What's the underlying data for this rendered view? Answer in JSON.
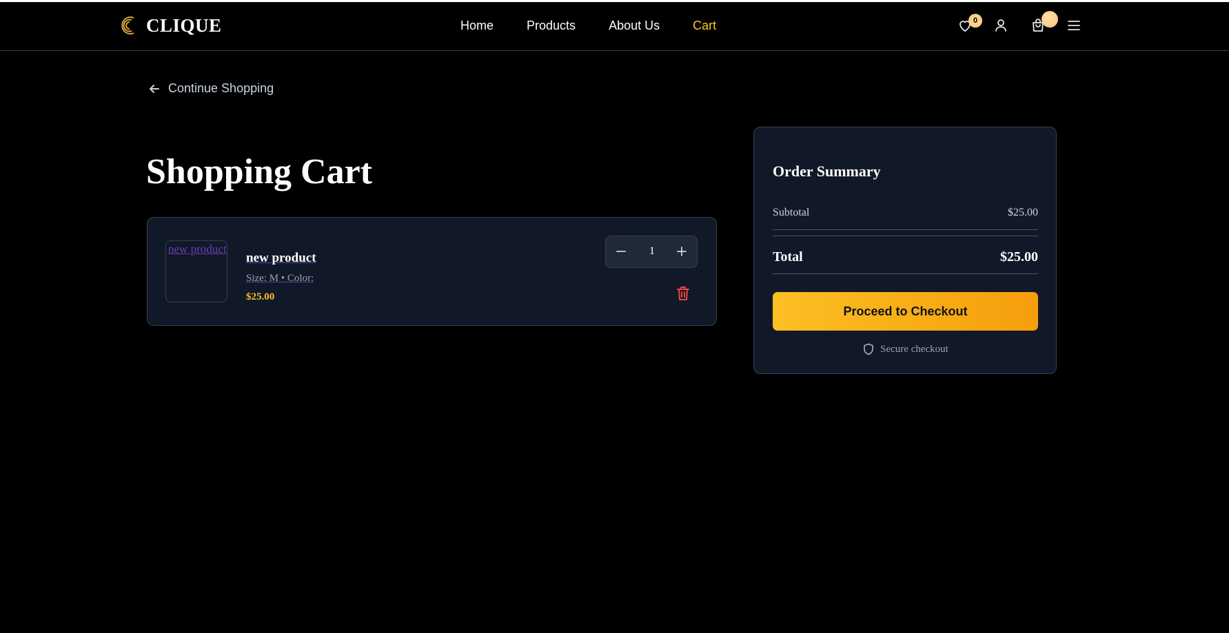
{
  "header": {
    "brand": "CLIQUE",
    "nav": [
      {
        "label": "Home",
        "active": false
      },
      {
        "label": "Products",
        "active": false
      },
      {
        "label": "About Us",
        "active": false
      },
      {
        "label": "Cart",
        "active": true
      }
    ],
    "wishlist_count": "0",
    "icons": [
      "heart-icon",
      "user-icon",
      "shopping-bag-icon",
      "menu-icon"
    ]
  },
  "back_link": "Continue Shopping",
  "page_title": "Shopping Cart",
  "cart": {
    "items": [
      {
        "image_alt": "new product",
        "name": "new product",
        "meta": "Size: M • Color:",
        "price": "$25.00",
        "quantity": "1"
      }
    ]
  },
  "summary": {
    "title": "Order Summary",
    "subtotal_label": "Subtotal",
    "subtotal_value": "$25.00",
    "total_label": "Total",
    "total_value": "$25.00",
    "checkout_label": "Proceed to Checkout",
    "secure_label": "Secure checkout"
  },
  "colors": {
    "background": "#000000",
    "card": "#111827",
    "accent": "#facc15",
    "checkout_start": "#fbbf24",
    "checkout_end": "#f59e0b",
    "delete": "#ef4444"
  }
}
